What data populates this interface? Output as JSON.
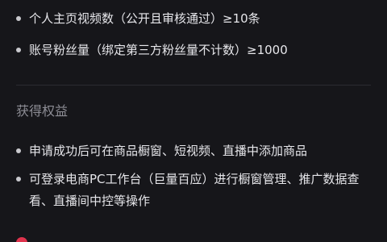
{
  "requirements": {
    "items": [
      {
        "text": "个人主页视频数（公开且审核通过）≥10条"
      },
      {
        "text": "账号粉丝量（绑定第三方粉丝量不计数）≥1000"
      }
    ]
  },
  "benefits": {
    "heading": "获得权益",
    "items": [
      {
        "text": "申请成功后可在商品橱窗、短视频、直播中添加商品"
      },
      {
        "text": "可登录电商PC工作台（巨量百应）进行橱窗管理、推广数据查看、直播间中控等操作"
      }
    ]
  },
  "colors": {
    "background": "#16161a",
    "text": "#e6e6ea",
    "muted_heading": "#8d8d95",
    "accent": "#e0334d"
  }
}
